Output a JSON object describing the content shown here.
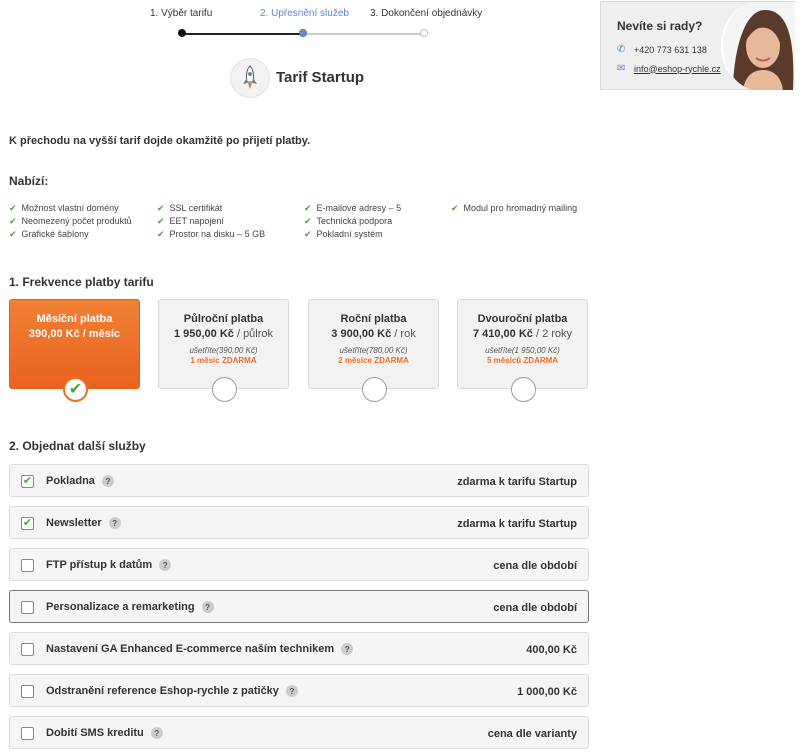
{
  "stepper": {
    "steps": [
      {
        "label": "1. Výběr tarifu"
      },
      {
        "label": "2. Upřesnění služeb"
      },
      {
        "label": "3. Dokončení objednávky"
      }
    ]
  },
  "tariff": {
    "title": "Tarif Startup",
    "icon": "rocket-icon"
  },
  "help": {
    "title": "Nevíte si rady?",
    "phone": "+420 773 631 138",
    "email": "info@eshop-rychle.cz"
  },
  "intro": "K přechodu na vyšší tarif dojde okamžitě po přijetí platby.",
  "offers": {
    "heading": "Nabízí:",
    "items": [
      "Možnost vlastní domény",
      "Neomezený počet produktů",
      "Grafické šablony",
      "SSL certifikát",
      "EET napojení",
      "Prostor na disku – 5 GB",
      "E-mailové adresy – 5",
      "Technická podpora",
      "Pokladní systém",
      "Modul pro hromadný mailing"
    ]
  },
  "frequency": {
    "heading": "1. Frekvence platby tarifu",
    "options": [
      {
        "name": "Měsíční platba",
        "price": "390,00 Kč",
        "per": "/ měsíc",
        "save": "",
        "free": "",
        "selected": true
      },
      {
        "name": "Půlroční platba",
        "price": "1 950,00 Kč",
        "per": "/ půlrok",
        "save": "ušetříte(390,00 Kč)",
        "free": "1 měsíc ZDARMA",
        "selected": false
      },
      {
        "name": "Roční platba",
        "price": "3 900,00 Kč",
        "per": "/ rok",
        "save": "ušetříte(780,00 Kč)",
        "free": "2 měsíce ZDARMA",
        "selected": false
      },
      {
        "name": "Dvouroční platba",
        "price": "7 410,00 Kč",
        "per": "/ 2 roky",
        "save": "ušetříte(1 950,00 Kč)",
        "free": "5 měsíců ZDARMA",
        "selected": false
      }
    ]
  },
  "services": {
    "heading": "2. Objednat další služby",
    "items": [
      {
        "name": "Pokladna",
        "price": "zdarma k tarifu Startup",
        "checked": true
      },
      {
        "name": "Newsletter",
        "price": "zdarma k tarifu Startup",
        "checked": true
      },
      {
        "name": "FTP přístup k datům",
        "price": "cena dle období",
        "checked": false
      },
      {
        "name": "Personalizace a remarketing",
        "price": "cena dle období",
        "checked": false
      },
      {
        "name": "Nastavení GA Enhanced E-commerce naším technikem",
        "price": "400,00 Kč",
        "checked": false
      },
      {
        "name": "Odstranění reference Eshop-rychle z patičky",
        "price": "1 000,00 Kč",
        "checked": false
      },
      {
        "name": "Dobití SMS kreditu",
        "price": "cena dle varianty",
        "checked": false
      }
    ],
    "help_symbol": "?"
  },
  "colors": {
    "accent": "#ee6f24",
    "check": "#4ba63a",
    "link": "#5a86c8"
  }
}
